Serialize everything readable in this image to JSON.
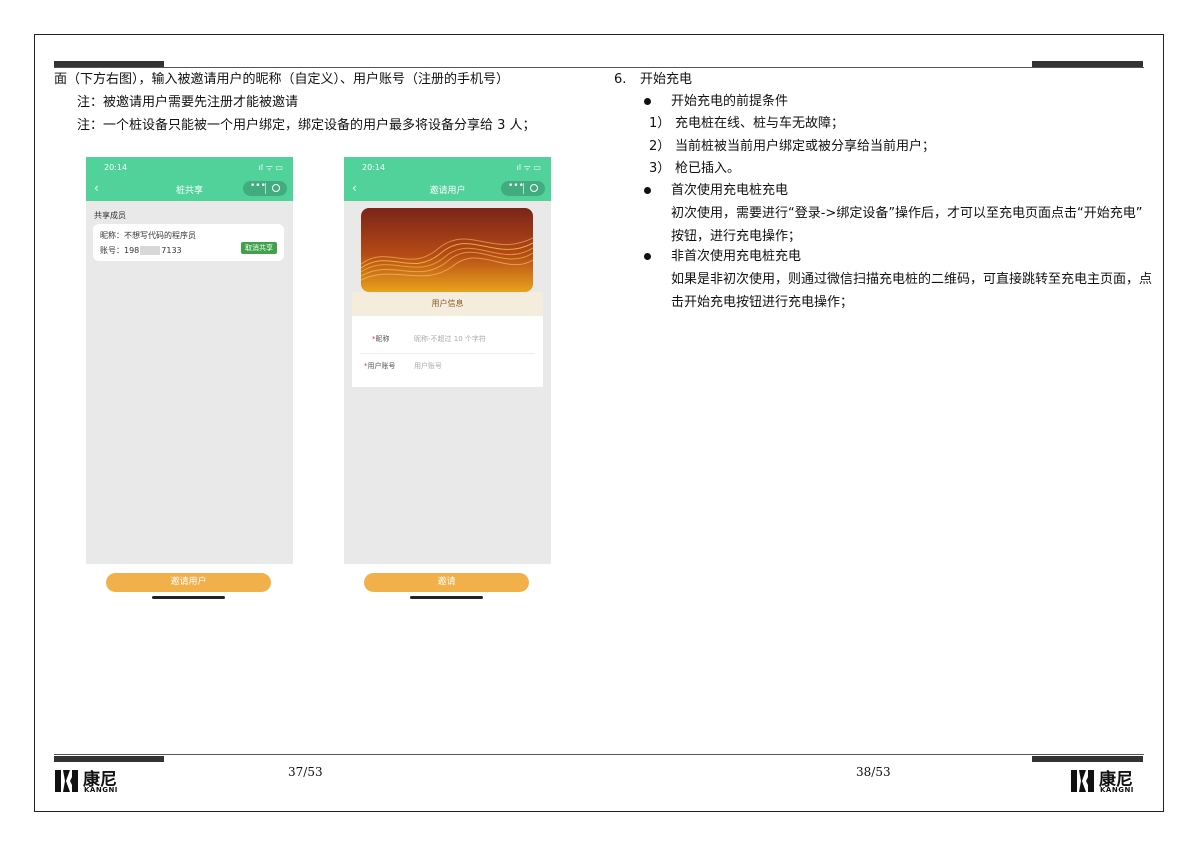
{
  "left_page": {
    "line1": "面（下方右图），输入被邀请用户的昵称（自定义）、用户账号（注册的手机号）",
    "note1": "注：被邀请用户需要先注册才能被邀请",
    "note2": "注：一个桩设备只能被一个用户绑定，绑定设备的用户最多将设备分享给 3 人；",
    "page_number": "37/53"
  },
  "phone1": {
    "time": "20:14",
    "signal": "ıl ᯤ ▭",
    "title": "桩共享",
    "section": "共享成员",
    "nickname_line": "昵称：不想写代码的程序员",
    "account_prefix": "账号：198",
    "account_suffix": "7133",
    "cancel_label": "取消共享",
    "bottom_button": "邀请用户"
  },
  "phone2": {
    "time": "20:14",
    "signal": "ıl ᯤ ▭",
    "title": "邀请用户",
    "card_title": "用户信息",
    "field1_label": "*昵称",
    "field1_placeholder": "昵称-不超过 10 个字符",
    "field2_label": "*用户账号",
    "field2_placeholder": "用户账号",
    "bottom_button": "邀请"
  },
  "right_page": {
    "section_num": "6.",
    "section_title": "开始充电",
    "bullet1": "开始充电的前提条件",
    "cond1_num": "1）",
    "cond1": "充电桩在线、桩与车无故障；",
    "cond2_num": "2）",
    "cond2": "当前桩被当前用户绑定或被分享给当前用户；",
    "cond3_num": "3）",
    "cond3": "枪已插入。",
    "bullet2": "首次使用充电桩充电",
    "para2_line1": "初次使用，需要进行“登录->绑定设备”操作后，才可以至充电页面点击“开始充电”",
    "para2_line2": "按钮，进行充电操作；",
    "bullet3": "非首次使用充电桩充电",
    "para3_line1": "如果是非初次使用，则通过微信扫描充电桩的二维码，可直接跳转至充电主页面，点",
    "para3_line2": "击开始充电按钮进行充电操作；",
    "page_number": "38/53"
  },
  "logo": {
    "name_cn": "康尼",
    "name_en": "KANGNI"
  },
  "colors": {
    "accent_green": "#50d29a",
    "button_orange": "#f1b04a",
    "cancel_green": "#3fa14a"
  }
}
